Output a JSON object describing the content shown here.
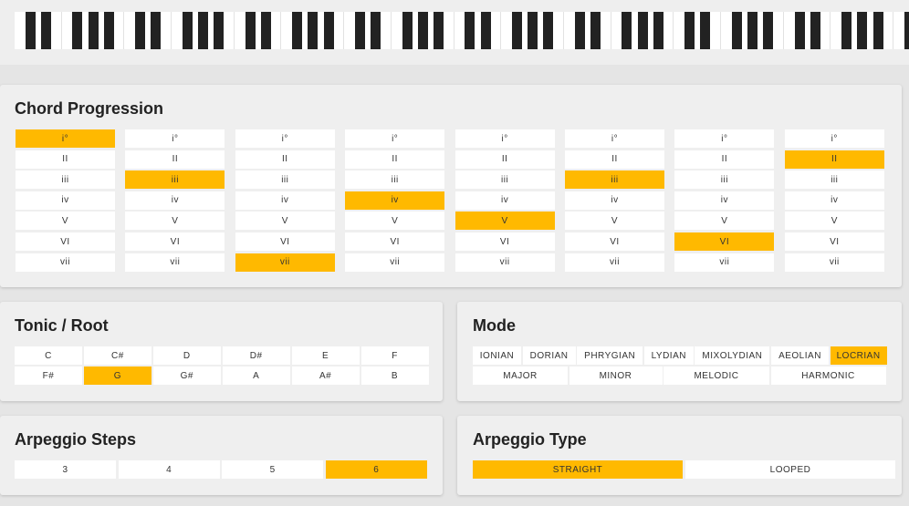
{
  "accent_color": "#ffb900",
  "chord_progression": {
    "title": "Chord Progression",
    "degrees": [
      "i°",
      "II",
      "iii",
      "iv",
      "V",
      "VI",
      "vii"
    ],
    "selected": [
      0,
      2,
      6,
      3,
      4,
      2,
      5,
      1
    ]
  },
  "tonic": {
    "title": "Tonic / Root",
    "notes": [
      "C",
      "C#",
      "D",
      "D#",
      "E",
      "F",
      "F#",
      "G",
      "G#",
      "A",
      "A#",
      "B"
    ],
    "selected": "G"
  },
  "mode": {
    "title": "Mode",
    "modes": [
      "IONIAN",
      "DORIAN",
      "PHRYGIAN",
      "LYDIAN",
      "MIXOLYDIAN",
      "AEOLIAN",
      "LOCRIAN"
    ],
    "scales": [
      "MAJOR",
      "MINOR",
      "MELODIC",
      "HARMONIC"
    ],
    "selected": "LOCRIAN"
  },
  "arp_steps": {
    "title": "Arpeggio Steps",
    "steps": [
      "3",
      "4",
      "5",
      "6"
    ],
    "selected": "6"
  },
  "arp_type": {
    "title": "Arpeggio Type",
    "types": [
      "STRAIGHT",
      "LOOPED"
    ],
    "selected": "STRAIGHT"
  }
}
